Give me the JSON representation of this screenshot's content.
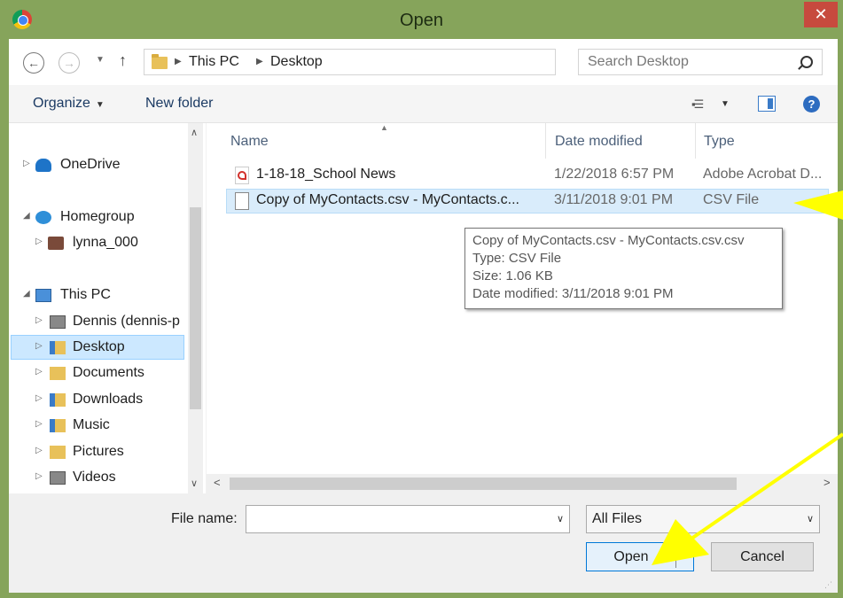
{
  "window": {
    "title": "Open",
    "close_glyph": "✕",
    "icon": "chrome-icon"
  },
  "addressbar": {
    "crumbs": [
      "This PC",
      "Desktop"
    ],
    "search_placeholder": "Search Desktop"
  },
  "toolbar": {
    "organize_label": "Organize",
    "new_folder_label": "New folder"
  },
  "nav": {
    "items": [
      {
        "label": "OneDrive",
        "icon": "onedrive-icon"
      },
      {
        "label": "Homegroup",
        "icon": "homegroup-icon"
      },
      {
        "label": "lynna_000",
        "icon": "user-avatar-icon"
      },
      {
        "label": "This PC",
        "icon": "computer-icon"
      },
      {
        "label": "Dennis (dennis-p",
        "icon": "network-drive-icon"
      },
      {
        "label": "Desktop",
        "icon": "desktop-folder-icon"
      },
      {
        "label": "Documents",
        "icon": "documents-folder-icon"
      },
      {
        "label": "Downloads",
        "icon": "downloads-folder-icon"
      },
      {
        "label": "Music",
        "icon": "music-folder-icon"
      },
      {
        "label": "Pictures",
        "icon": "pictures-folder-icon"
      },
      {
        "label": "Videos",
        "icon": "videos-folder-icon"
      }
    ],
    "selected": "Desktop"
  },
  "files": {
    "columns": [
      "Name",
      "Date modified",
      "Type"
    ],
    "rows": [
      {
        "name": "1-18-18_School News",
        "date": "1/22/2018 6:57 PM",
        "type": "Adobe Acrobat D...",
        "icon": "pdf-icon"
      },
      {
        "name": "Copy of MyContacts.csv - MyContacts.c...",
        "date": "3/11/2018 9:01 PM",
        "type": "CSV File",
        "icon": "document-icon"
      }
    ],
    "selected_index": 1
  },
  "tooltip": {
    "line1": "Copy of MyContacts.csv - MyContacts.csv.csv",
    "line2": "Type: CSV File",
    "line3": "Size: 1.06 KB",
    "line4": "Date modified: 3/11/2018 9:01 PM"
  },
  "footer": {
    "file_name_label": "File name:",
    "file_name_value": "",
    "filter_value": "All Files",
    "open_label": "Open",
    "cancel_label": "Cancel"
  },
  "colors": {
    "frame": "#86a45b",
    "close": "#c74a3e",
    "selection": "#cce8ff",
    "annotation_arrow": "#ffff00"
  }
}
